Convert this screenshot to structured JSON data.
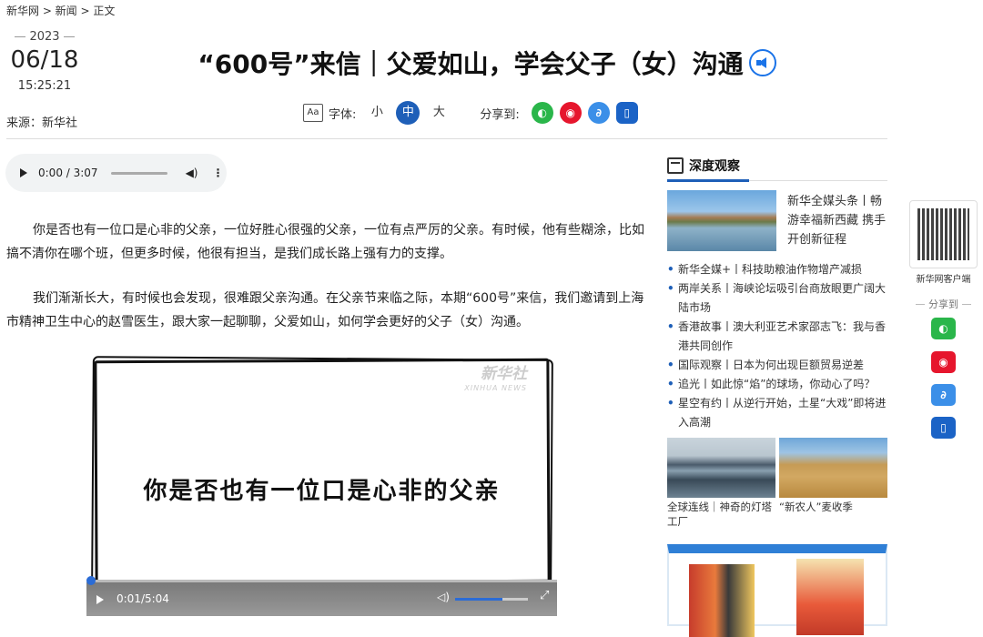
{
  "breadcrumb": "新华网 > 新闻 > 正文",
  "date": {
    "year": "2023",
    "day": "06/18",
    "time": "15:25:21"
  },
  "source": "来源：新华社",
  "title": "“600号”来信｜父爱如山，学会父子（女）沟通",
  "toolbar": {
    "font_label": "字体:",
    "small": "小",
    "medium": "中",
    "large": "大",
    "share_label": "分享到:",
    "share_icons": [
      "wechat-icon",
      "weibo-icon",
      "link-icon",
      "mobile-icon"
    ]
  },
  "audio": {
    "time": "0:00 / 3:07"
  },
  "paragraphs": [
    "你是否也有一位口是心非的父亲，一位好胜心很强的父亲，一位有点严厉的父亲。有时候，他有些糊涂，比如搞不清你在哪个班，但更多时候，他很有担当，是我们成长路上强有力的支撑。",
    "我们渐渐长大，有时候也会发现，很难跟父亲沟通。在父亲节来临之际，本期“600号”来信，我们邀请到上海市精神卫生中心的赵雪医生，跟大家一起聊聊，父爱如山，如何学会更好的父子（女）沟通。"
  ],
  "video": {
    "subtitle": "你是否也有一位口是心非的父亲",
    "watermark": "新华社",
    "watermark_en": "XINHUA NEWS",
    "time": "0:01/5:04",
    "volume": 0.65
  },
  "sidebar": {
    "heading": "深度观察",
    "featured_title": "新华全媒头条丨畅游幸福新西藏 携手开创新征程",
    "items": [
      "新华全媒+丨科技助粮油作物增产减损",
      "两岸关系丨海峡论坛吸引台商放眼更广阔大陆市场",
      "香港故事丨澳大利亚艺术家邵志飞：我与香港共同创作",
      "国际观察丨日本为何出现巨额贸易逆差",
      "追光丨如此惊“焰”的球场，你动心了吗？",
      "星空有约丨从逆行开始，土星“大戏”即将进入高潮"
    ],
    "pic1_caption": "全球连线｜神奇的灯塔工厂",
    "pic2_caption": "“新农人”麦收季"
  },
  "right_rail": {
    "qr_label": "新华网客户端",
    "share_label": "分享到"
  },
  "colors": {
    "accent": "#1e5fb8",
    "wechat": "#2ab64a",
    "weibo": "#e6162d",
    "link": "#3b8fe8",
    "mobile": "#1b63c6"
  }
}
